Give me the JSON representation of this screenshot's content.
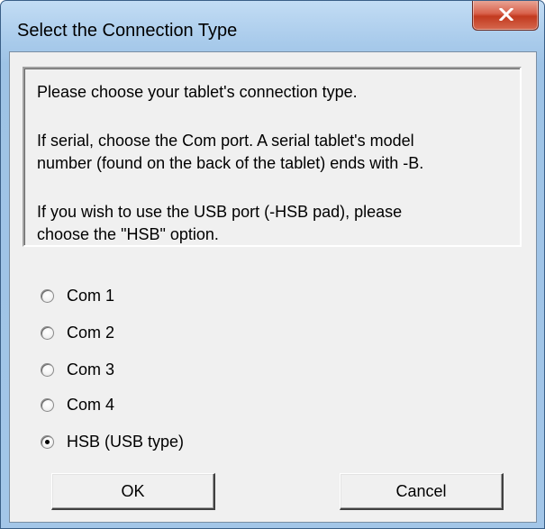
{
  "window": {
    "title": "Select the Connection Type",
    "close_symbol": "x"
  },
  "message": {
    "line1": "Please choose your tablet's connection type.",
    "line2": "If serial, choose the Com port. A serial tablet's model",
    "line3": "number (found on the back of the tablet) ends with -B.",
    "line4": "If you wish to use the USB port (-HSB pad), please",
    "line5": "choose the \"HSB\" option."
  },
  "options": [
    {
      "label": "Com 1",
      "checked": false
    },
    {
      "label": "Com 2",
      "checked": false
    },
    {
      "label": "Com 3",
      "checked": false
    },
    {
      "label": "Com 4",
      "checked": false
    },
    {
      "label": "HSB (USB type)",
      "checked": true
    }
  ],
  "buttons": {
    "ok_label": "OK",
    "cancel_label": "Cancel"
  },
  "colors": {
    "titlebar": "#a9cbeb",
    "close_button": "#c23a1f",
    "dialog_face": "#f0f0f0"
  },
  "icons": {
    "close": "close-icon",
    "radio_unchecked": "radio-unchecked",
    "radio_checked": "radio-checked"
  }
}
